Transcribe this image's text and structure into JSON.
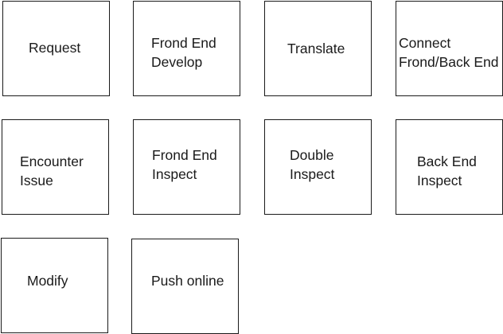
{
  "diagram": {
    "boxes": [
      {
        "id": "request",
        "label": "Request"
      },
      {
        "id": "frond-end-develop",
        "label": "Frond End\nDevelop"
      },
      {
        "id": "translate",
        "label": "Translate"
      },
      {
        "id": "connect",
        "label": "Connect\nFrond/Back End"
      },
      {
        "id": "encounter-issue",
        "label": "Encounter\nIssue"
      },
      {
        "id": "frond-end-inspect",
        "label": "Frond End\nInspect"
      },
      {
        "id": "double-inspect",
        "label": "Double\nInspect"
      },
      {
        "id": "back-end-inspect",
        "label": "Back End\nInspect"
      },
      {
        "id": "modify",
        "label": "Modify"
      },
      {
        "id": "push-online",
        "label": "Push online"
      }
    ]
  }
}
